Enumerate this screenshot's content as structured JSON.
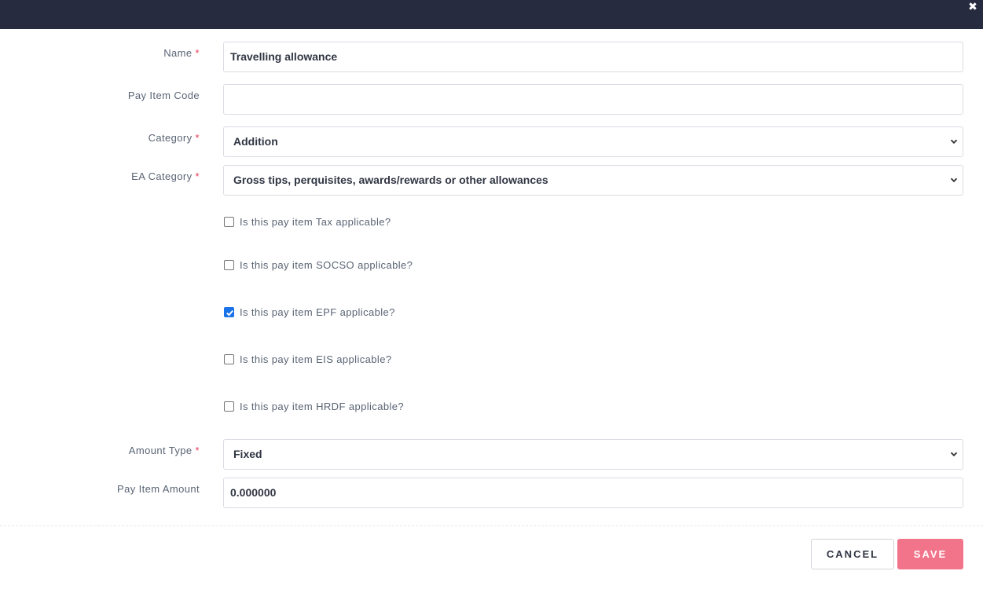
{
  "header": {
    "close_icon": "close-icon"
  },
  "form": {
    "name": {
      "label": "Name",
      "required_mark": "*",
      "value": "Travelling allowance"
    },
    "pay_item_code": {
      "label": "Pay Item Code",
      "value": ""
    },
    "category": {
      "label": "Category",
      "required_mark": "*",
      "selected": "Addition"
    },
    "ea_category": {
      "label": "EA Category",
      "required_mark": "*",
      "selected": "Gross tips, perquisites, awards/rewards or other allowances"
    },
    "checkboxes": [
      {
        "label": "Is this pay item Tax applicable?",
        "checked": false
      },
      {
        "label": "Is this pay item SOCSO applicable?",
        "checked": false
      },
      {
        "label": "Is this pay item EPF applicable?",
        "checked": true
      },
      {
        "label": "Is this pay item EIS applicable?",
        "checked": false
      },
      {
        "label": "Is this pay item HRDF applicable?",
        "checked": false
      }
    ],
    "amount_type": {
      "label": "Amount Type",
      "required_mark": "*",
      "selected": "Fixed"
    },
    "pay_item_amount": {
      "label": "Pay Item Amount",
      "value": "0.000000"
    }
  },
  "footer": {
    "cancel_label": "CANCEL",
    "save_label": "SAVE"
  },
  "colors": {
    "topbar": "#262b40",
    "required": "#e23b57",
    "save_button": "#f1748a",
    "checkbox_checked": "#1a73e8"
  }
}
